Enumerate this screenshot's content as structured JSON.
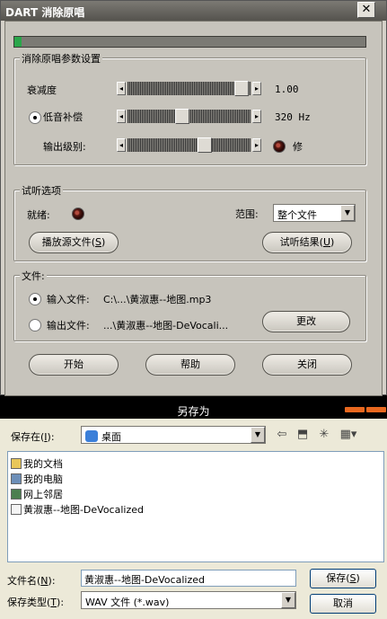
{
  "dart": {
    "title": "DART 消除原唱",
    "close_glyph": "✕",
    "meter_level": 0.02,
    "params": {
      "legend": "消除原唱参数设置",
      "attenuation_label": "衰减度",
      "attenuation_value": "1.00",
      "bass_label": "低音补偿",
      "bass_checked": true,
      "bass_value": "320 Hz",
      "output_label": "输出级别:",
      "repair_label": "修"
    },
    "preview": {
      "legend": "试听选项",
      "ready_label": "就绪:",
      "range_label": "范围:",
      "range_value": "整个文件",
      "play_source_label": "播放源文件",
      "play_source_key": "S",
      "preview_result_label": "试听结果",
      "preview_result_key": "U"
    },
    "file": {
      "legend": "文件:",
      "input_label": "输入文件:",
      "input_value": "C:\\...\\黄淑惠--地图.mp3",
      "output_label": "输出文件:",
      "output_value": "...\\黄淑惠--地图-DeVocali...",
      "change_label": "更改"
    },
    "buttons": {
      "start": "开始",
      "help": "帮助",
      "close": "关闭"
    }
  },
  "save_dialog": {
    "title": "另存为",
    "save_in_label": "保存在",
    "save_in_key": "I",
    "save_in_value": "桌面",
    "items": [
      {
        "label": "我的文档",
        "icon": "folder-icon"
      },
      {
        "label": "我的电脑",
        "icon": "computer-icon"
      },
      {
        "label": "网上邻居",
        "icon": "network-icon"
      },
      {
        "label": "黄淑惠--地图-DeVocalized",
        "icon": "audio-file-icon"
      }
    ],
    "filename_label": "文件名",
    "filename_key": "N",
    "filename_value": "黄淑惠--地图-DeVocalized",
    "filetype_label": "保存类型",
    "filetype_key": "T",
    "filetype_value": "WAV 文件 (*.wav)",
    "save_button": "保存",
    "save_key": "S",
    "cancel_button": "取消"
  }
}
